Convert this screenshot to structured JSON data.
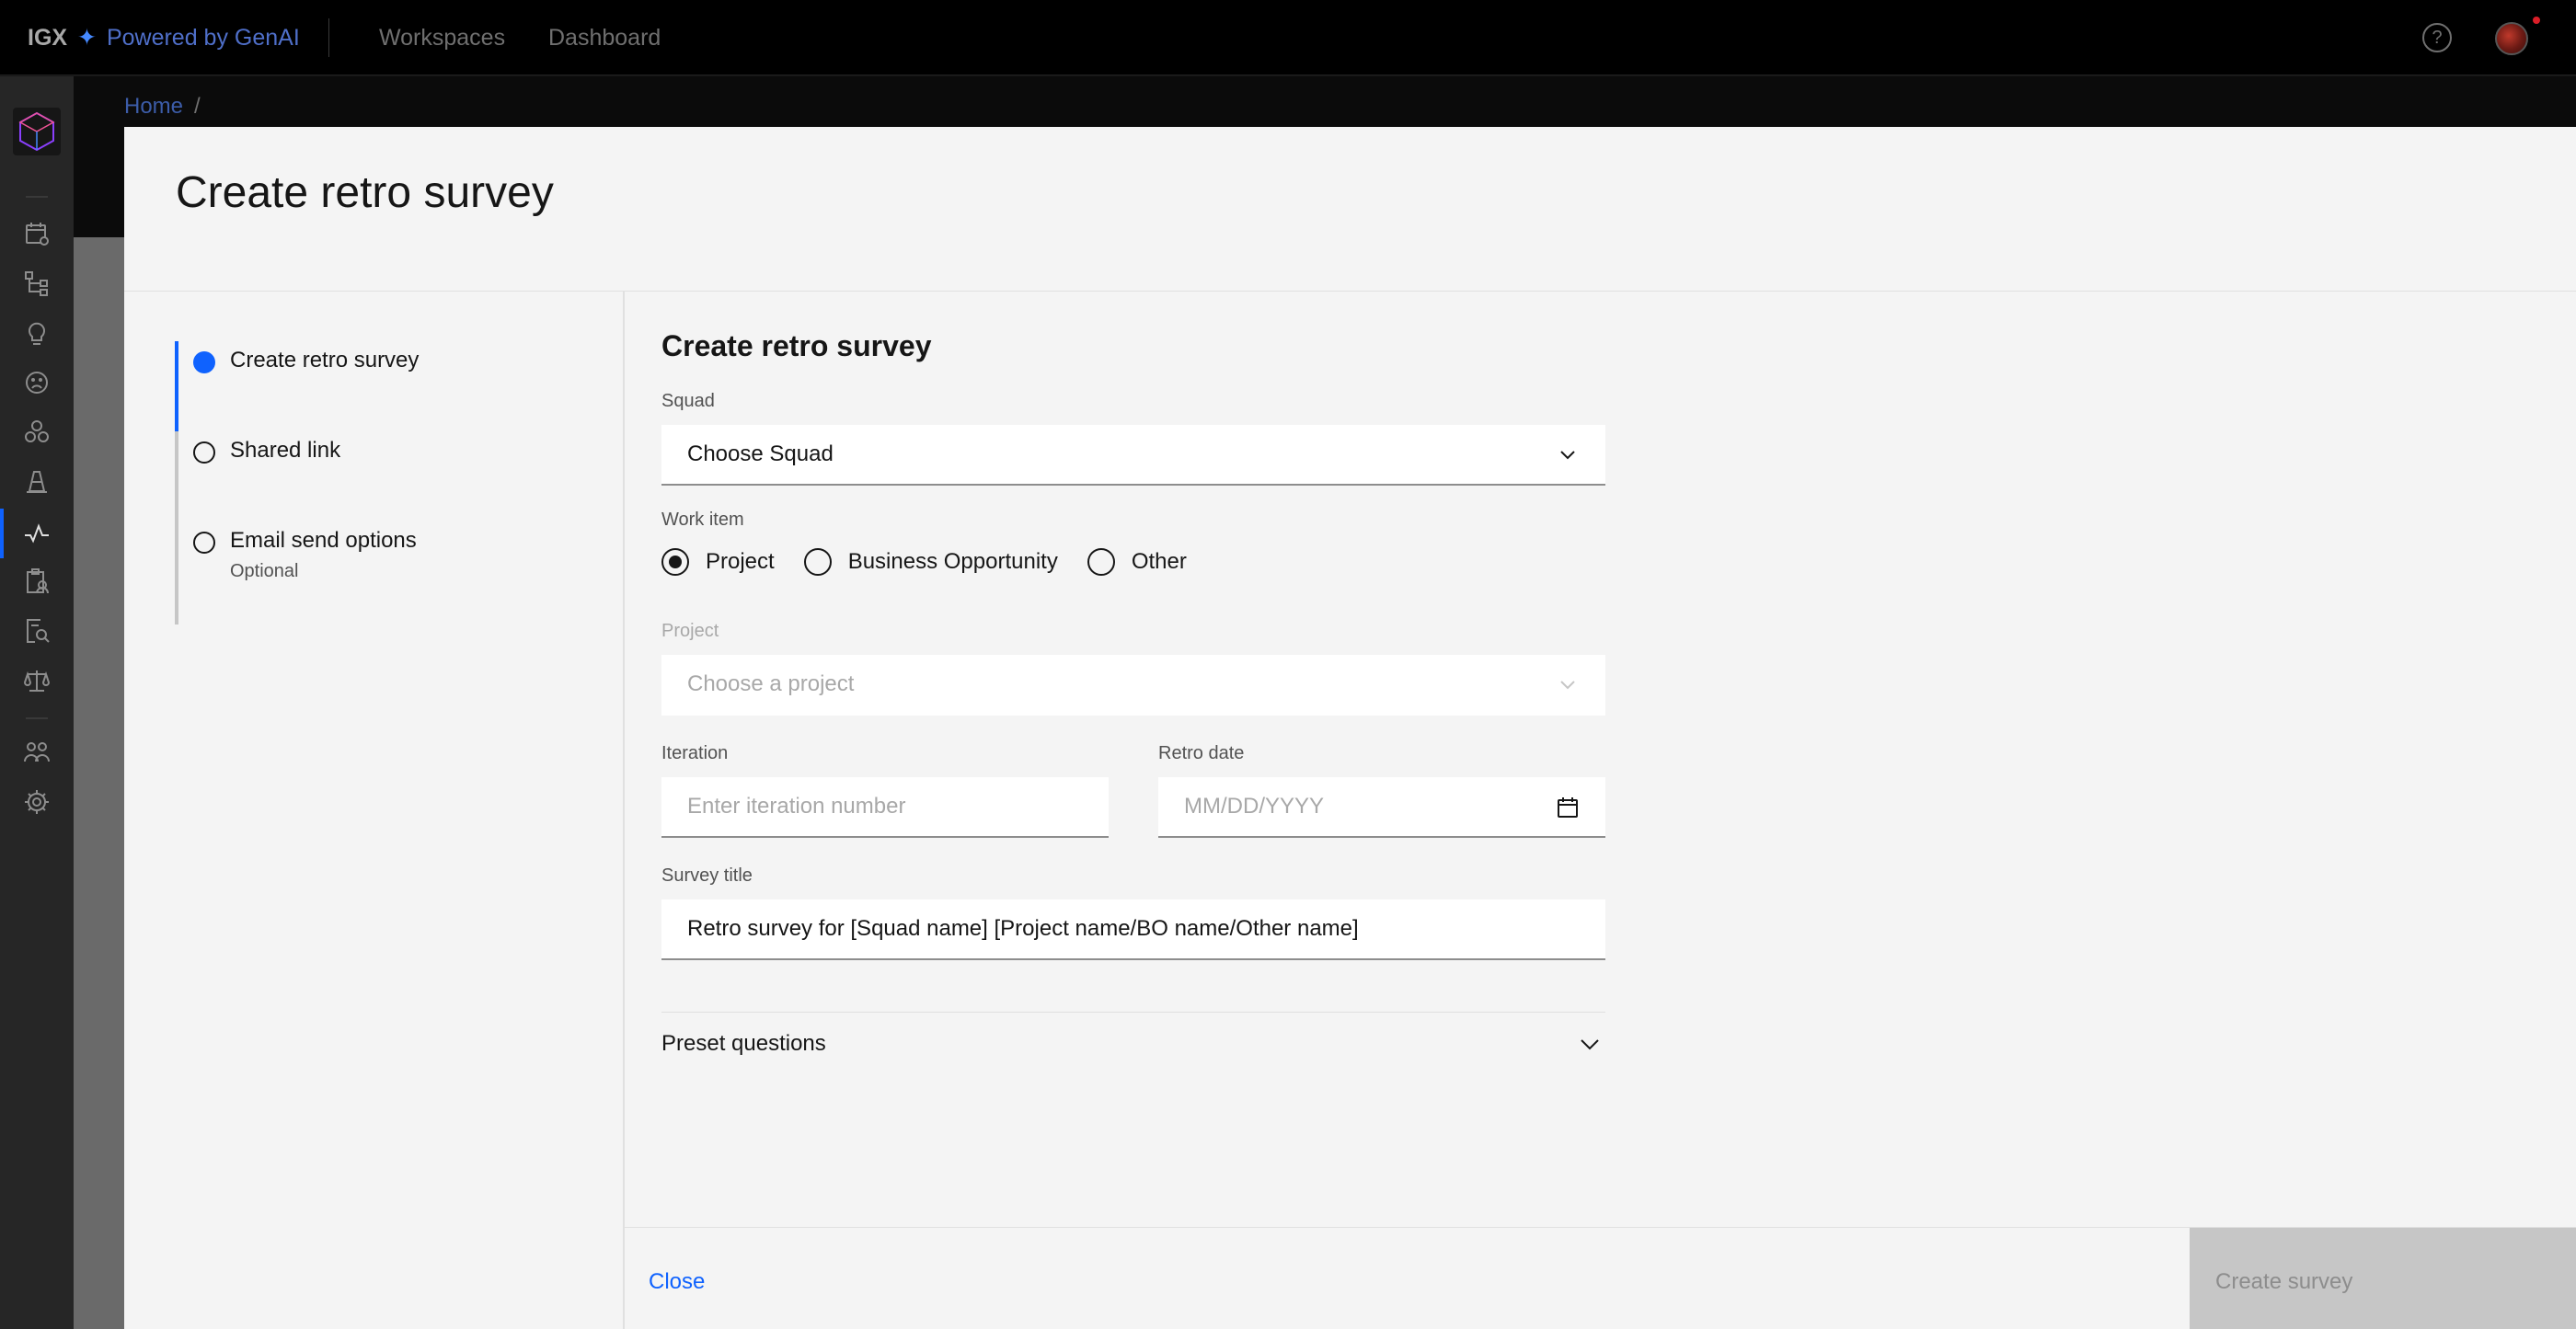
{
  "header": {
    "brand_name": "IGX",
    "brand_separator": "✦",
    "brand_tagline": "Powered by GenAI",
    "nav": [
      {
        "label": "Workspaces"
      },
      {
        "label": "Dashboard"
      }
    ],
    "help_glyph": "?",
    "help_icon": "help-circle-icon",
    "avatar_icon": "user-avatar"
  },
  "rail": {
    "icons": [
      "calendar-settings-icon",
      "hierarchy-icon",
      "idea-icon",
      "sad-face-icon",
      "group-objects-icon",
      "traffic-cone-icon",
      "activity-pulse-icon",
      "clipboard-user-icon",
      "document-search-icon",
      "scales-icon",
      "users-icon",
      "settings-icon"
    ],
    "active_index": 6
  },
  "background": {
    "breadcrumb_home": "Home",
    "breadcrumb_sep": "/"
  },
  "modal": {
    "title": "Create retro survey",
    "steps": [
      {
        "label": "Create retro survey",
        "sublabel": "",
        "state": "current"
      },
      {
        "label": "Shared link",
        "sublabel": "",
        "state": "incomplete"
      },
      {
        "label": "Email send options",
        "sublabel": "Optional",
        "state": "incomplete"
      }
    ],
    "form": {
      "heading": "Create retro survey",
      "squad_label": "Squad",
      "squad_value": "Choose Squad",
      "work_item_label": "Work item",
      "work_item_options": [
        {
          "label": "Project",
          "checked": true
        },
        {
          "label": "Business Opportunity",
          "checked": false
        },
        {
          "label": "Other",
          "checked": false
        }
      ],
      "project_label": "Project",
      "project_value": "Choose a project",
      "iteration_label": "Iteration",
      "iteration_placeholder": "Enter iteration number",
      "retro_date_label": "Retro date",
      "retro_date_placeholder": "MM/DD/YYYY",
      "survey_title_label": "Survey title",
      "survey_title_value": "Retro survey for [Squad name] [Project name/BO name/Other name]",
      "preset_questions_label": "Preset questions"
    },
    "footer": {
      "close_label": "Close",
      "create_label": "Create survey"
    }
  },
  "colors": {
    "primary": "#0f62fe",
    "topbar_bg": "#000000",
    "rail_bg": "#262626",
    "modal_bg": "#f4f4f4",
    "disabled_button": "#c6c6c6"
  }
}
